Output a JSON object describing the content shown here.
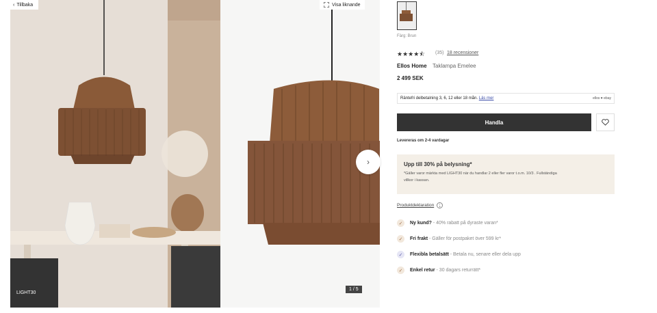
{
  "gallery": {
    "back_label": "Tillbaka",
    "zoom_label": "Visa liknande",
    "code_badge": "LIGHT30",
    "counter": "1 / 5",
    "next_icon": "chevron-right-icon"
  },
  "product": {
    "color_label": "Färg: Brun",
    "rating_count": "(35)",
    "reviews_link": "18 recensioner",
    "brand": "Ellos Home",
    "name": "Taklampa Emelee",
    "price": "2 499 SEK",
    "rating": 4.5
  },
  "finance": {
    "text": "Räntefri delbetalning 3, 6, 12 eller 18 mån.",
    "link": "Läs mer",
    "providers": "ellos ♥ ebay"
  },
  "actions": {
    "buy_label": "Handla",
    "delivery": "Levereras om 2-4 vardagar"
  },
  "promo": {
    "title": "Upp till 30% på belysning*",
    "text_1": "*Gäller varor märkta med LIGHT30 när du handlar 2 eller fler varor t.o.m. 10/3 . Fullständiga",
    "text_2": "villkor i kassan."
  },
  "declaration_link": "Produktdeklaration",
  "usps": [
    {
      "bold": "Ny kund?",
      "text": " - 40% rabatt på dyraste varan*"
    },
    {
      "bold": "Fri frakt",
      "text": " - Gäller för postpaket över 599 kr*"
    },
    {
      "bold": "Flexibla betalsätt",
      "text": " - Betala nu, senare eller dela upp"
    },
    {
      "bold": "Enkel retur",
      "text": " - 30 dagars returrätt*"
    }
  ],
  "colors": {
    "dark": "#333333",
    "promo_bg": "#f4efe7",
    "rattan": "#8a5a38"
  }
}
